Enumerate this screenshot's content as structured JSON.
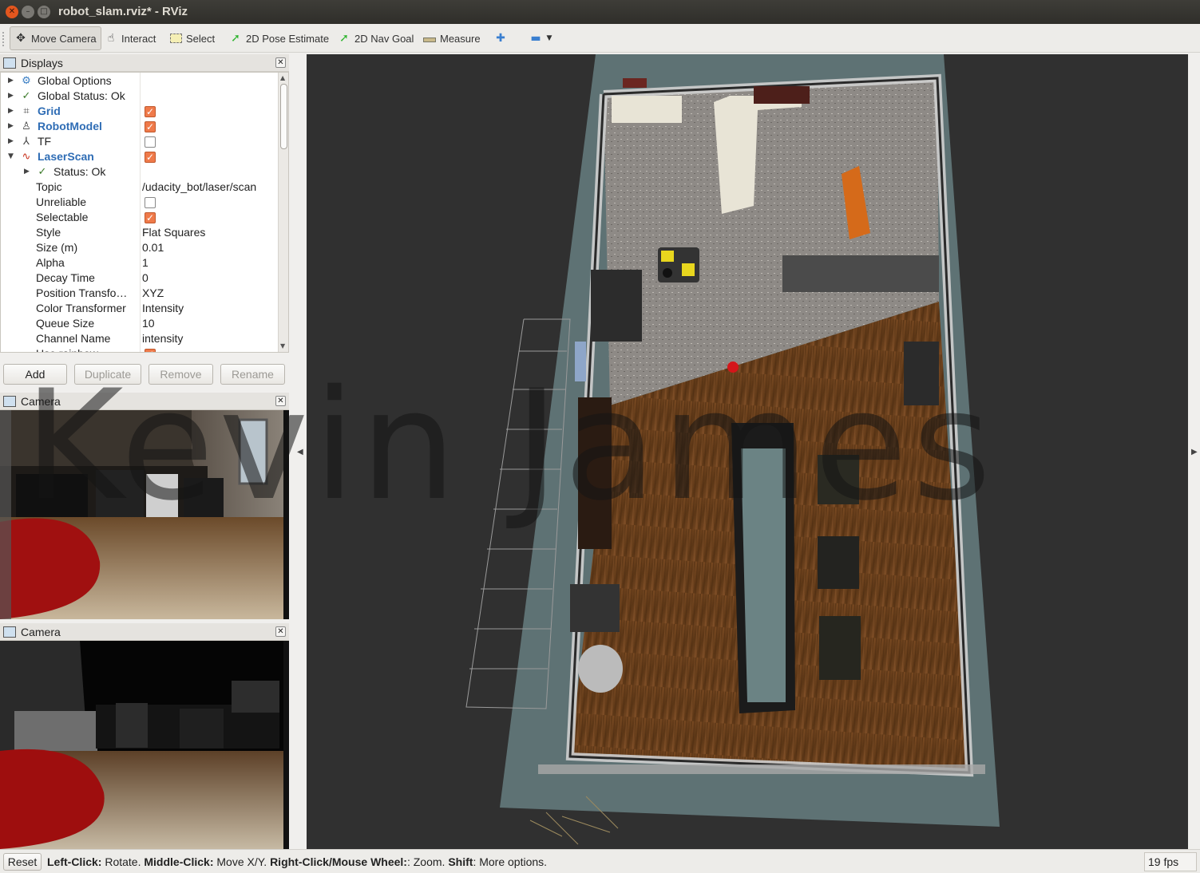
{
  "window": {
    "title": "robot_slam.rviz* - RViz"
  },
  "toolbar": {
    "move_camera": "Move Camera",
    "interact": "Interact",
    "select": "Select",
    "pose_estimate": "2D Pose Estimate",
    "nav_goal": "2D Nav Goal",
    "measure": "Measure"
  },
  "displays": {
    "title": "Displays",
    "items": [
      {
        "name": "Global Options"
      },
      {
        "name": "Global Status: Ok"
      },
      {
        "name": "Grid",
        "checked": true
      },
      {
        "name": "RobotModel",
        "checked": true
      },
      {
        "name": "TF",
        "checked": false
      },
      {
        "name": "LaserScan",
        "checked": true
      },
      {
        "name": "Status: Ok"
      }
    ],
    "properties": [
      {
        "name": "Topic",
        "value": "/udacity_bot/laser/scan"
      },
      {
        "name": "Unreliable",
        "checked": false
      },
      {
        "name": "Selectable",
        "checked": true
      },
      {
        "name": "Style",
        "value": "Flat Squares"
      },
      {
        "name": "Size (m)",
        "value": "0.01"
      },
      {
        "name": "Alpha",
        "value": "1"
      },
      {
        "name": "Decay Time",
        "value": "0"
      },
      {
        "name": "Position Transfo…",
        "value": "XYZ"
      },
      {
        "name": "Color Transformer",
        "value": "Intensity"
      },
      {
        "name": "Queue Size",
        "value": "10"
      },
      {
        "name": "Channel Name",
        "value": "intensity"
      },
      {
        "name": "Use rainbow",
        "checked": true
      }
    ],
    "buttons": {
      "add": "Add",
      "duplicate": "Duplicate",
      "remove": "Remove",
      "rename": "Rename"
    }
  },
  "camera_panels": [
    {
      "title": "Camera"
    },
    {
      "title": "Camera"
    }
  ],
  "status_bar": {
    "reset": "Reset",
    "left_click": "Left-Click:",
    "left_click_desc": " Rotate. ",
    "middle_click": "Middle-Click:",
    "middle_click_desc": " Move X/Y. ",
    "right_click": "Right-Click/Mouse Wheel:",
    "right_click_desc": ": Zoom. ",
    "shift": "Shift",
    "shift_desc": ": More options.",
    "fps": "19 fps"
  },
  "watermark": "Kevin James",
  "colors": {
    "checkbox_on": "#ef7a4a",
    "blue_label": "#2f6db5",
    "view_bg": "#303030"
  }
}
